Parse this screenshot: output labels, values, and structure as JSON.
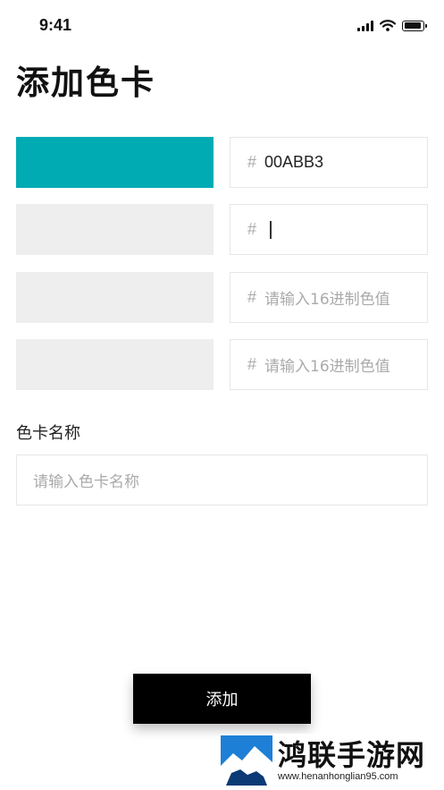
{
  "status_bar": {
    "time": "9:41"
  },
  "page": {
    "title": "添加色卡"
  },
  "color_rows": [
    {
      "swatch_color": "#00ABB3",
      "hash": "#",
      "value": "00ABB3",
      "placeholder": ""
    },
    {
      "swatch_color": "#EEEEEE",
      "hash": "#",
      "value": "",
      "placeholder": "",
      "focused": true
    },
    {
      "swatch_color": "#EEEEEE",
      "hash": "#",
      "value": "",
      "placeholder": "请输入16进制色值"
    },
    {
      "swatch_color": "#EEEEEE",
      "hash": "#",
      "value": "",
      "placeholder": "请输入16进制色值"
    }
  ],
  "name_section": {
    "label": "色卡名称",
    "placeholder": "请输入色卡名称"
  },
  "add_button": {
    "label": "添加"
  },
  "watermark": {
    "title": "鸿联手游网",
    "url": "www.henanhonglian95.com"
  },
  "colors": {
    "accent": "#00ABB3",
    "empty_swatch": "#EEEEEE",
    "button_bg": "#000000",
    "watermark_blue": "#1E7FD6"
  },
  "icons": [
    "signal-icon",
    "wifi-icon",
    "battery-icon",
    "watermark-logo"
  ]
}
